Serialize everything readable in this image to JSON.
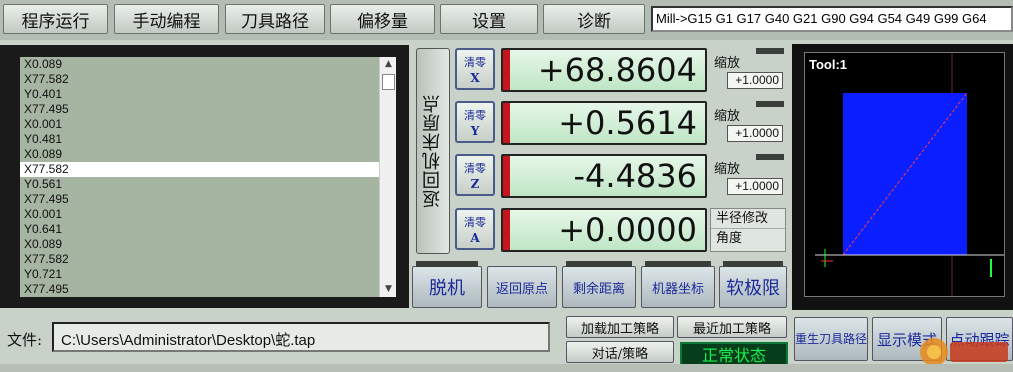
{
  "menu": {
    "items": [
      "程序运行",
      "手动编程",
      "刀具路径",
      "偏移量",
      "设置",
      "诊断"
    ]
  },
  "gcode_state": "Mill->G15  G1 G17 G40 G21 G90 G94 G54 G49 G99 G64",
  "code_list": {
    "rows": [
      "X0.089",
      "X77.582",
      "Y0.401",
      "X77.495",
      "X0.001",
      "Y0.481",
      "X0.089",
      "X77.582",
      "Y0.561",
      "X77.495",
      "X0.001",
      "Y0.641",
      "X0.089",
      "X77.582",
      "Y0.721",
      "X77.495"
    ],
    "selected_index": 7
  },
  "home_button_label": "返回机床原点",
  "axes": [
    {
      "zero_label": "清零",
      "axis": "X",
      "value": "+68.8604",
      "scale_label": "缩放",
      "scale": "+1.0000"
    },
    {
      "zero_label": "清零",
      "axis": "Y",
      "value": "+0.5614",
      "scale_label": "缩放",
      "scale": "+1.0000"
    },
    {
      "zero_label": "清零",
      "axis": "Z",
      "value": "-4.4836",
      "scale_label": "缩放",
      "scale": "+1.0000"
    },
    {
      "zero_label": "清零",
      "axis": "A",
      "value": "+0.0000"
    }
  ],
  "radius_box": {
    "line1": "半径修改",
    "line2": "角度"
  },
  "function_buttons": [
    "脱机",
    "返回原点",
    "剩余距离",
    "机器坐标",
    "软极限"
  ],
  "toolpath": {
    "tool_label": "Tool:1"
  },
  "file": {
    "label": "文件:",
    "path": "C:\\Users\\Administrator\\Desktop\\蛇.tap"
  },
  "buttons": {
    "load_strategy": "加载加工策略",
    "recent_strategy": "最近加工策略",
    "dialog_strategy": "对话/策略",
    "regen_toolpath": "重生刀具路径",
    "display_mode": "显示模式",
    "jog_follow": "点动跟踪"
  },
  "status": "正常状态",
  "colors": {
    "dro_indicator": "#c8141c",
    "status_text": "#19f04e",
    "toolpath_fill": "#0a1eff"
  }
}
